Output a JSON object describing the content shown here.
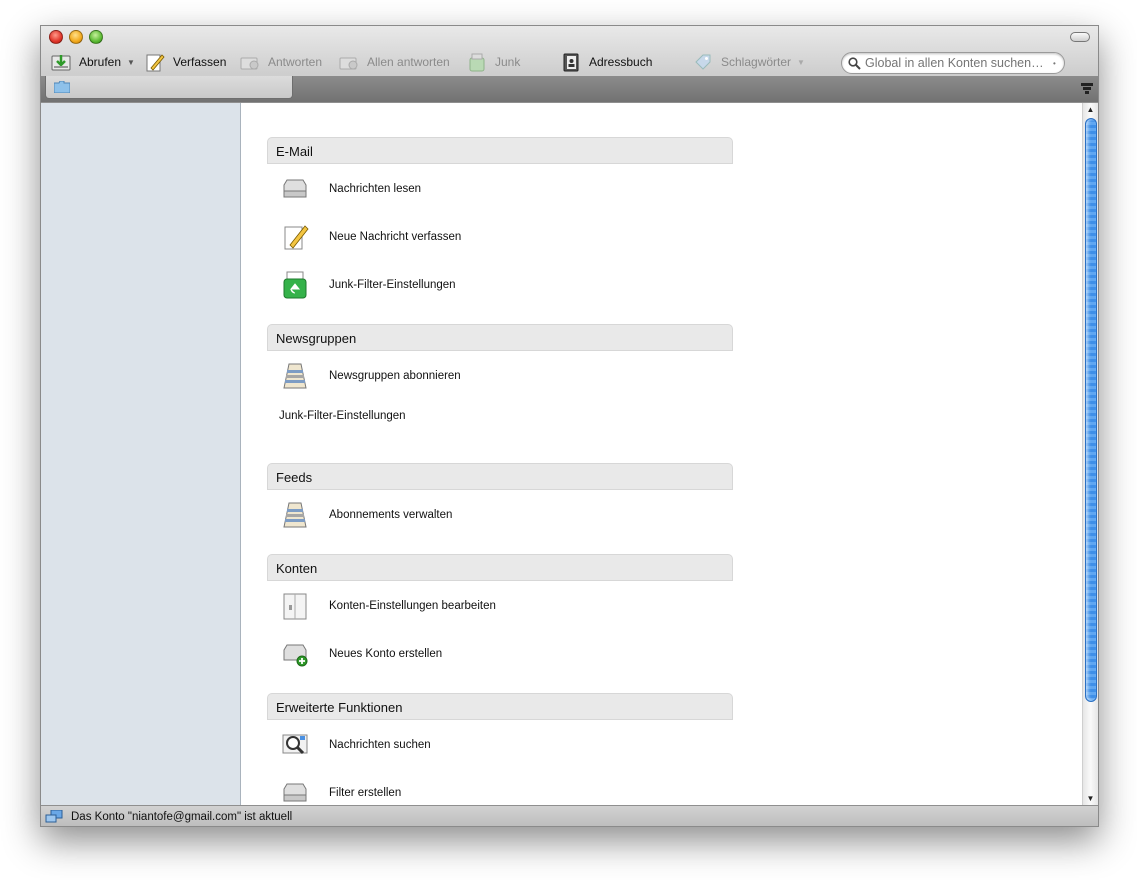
{
  "toolbar": {
    "get_messages": "Abrufen",
    "compose": "Verfassen",
    "reply": "Antworten",
    "reply_all": "Allen antworten",
    "junk": "Junk",
    "address_book": "Adressbuch",
    "tags": "Schlagwörter",
    "search_placeholder": "Global in allen Konten suchen…"
  },
  "sections": {
    "email": {
      "title": "E-Mail",
      "items": [
        {
          "label": "Nachrichten lesen",
          "icon": "inbox-tray-icon"
        },
        {
          "label": "Neue Nachricht verfassen",
          "icon": "pencil-paper-icon"
        },
        {
          "label": "Junk-Filter-Einstellungen",
          "icon": "recycle-bin-icon"
        }
      ]
    },
    "newsgroups": {
      "title": "Newsgruppen",
      "items": [
        {
          "label": "Newsgruppen abonnieren",
          "icon": "newsgroup-icon"
        }
      ],
      "plain": "Junk-Filter-Einstellungen"
    },
    "feeds": {
      "title": "Feeds",
      "items": [
        {
          "label": "Abonnements verwalten",
          "icon": "feeds-icon"
        }
      ]
    },
    "accounts": {
      "title": "Konten",
      "items": [
        {
          "label": "Konten-Einstellungen bearbeiten",
          "icon": "account-settings-icon"
        },
        {
          "label": "Neues Konto erstellen",
          "icon": "new-account-icon"
        }
      ]
    },
    "advanced": {
      "title": "Erweiterte Funktionen",
      "items": [
        {
          "label": "Nachrichten suchen",
          "icon": "search-messages-icon"
        },
        {
          "label": "Filter erstellen",
          "icon": "filter-icon"
        }
      ]
    }
  },
  "status": {
    "text": "Das Konto \"niantofe@gmail.com\" ist aktuell"
  },
  "colors": {
    "sidebar_bg": "#dce3ea",
    "section_header_bg": "#e9e9e9",
    "scroll_thumb": "#3e8fe8"
  }
}
